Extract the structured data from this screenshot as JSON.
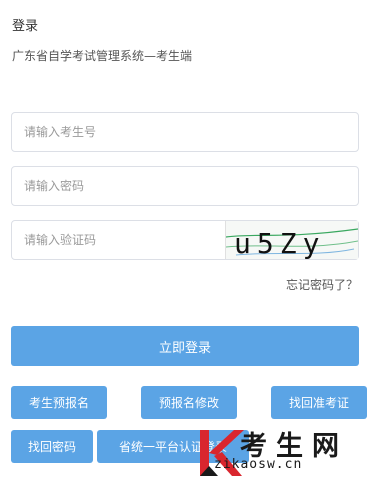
{
  "header": {
    "title": "登录",
    "subtitle": "广东省自学考试管理系统—考生端"
  },
  "form": {
    "username_placeholder": "请输入考生号",
    "password_placeholder": "请输入密码",
    "captcha_placeholder": "请输入验证码",
    "captcha_text": "u5Zy",
    "forgot_password": "忘记密码了？",
    "login_button": "立即登录"
  },
  "actions": [
    {
      "label": "考生预报名"
    },
    {
      "label": "预报名修改"
    },
    {
      "label": "找回准考证"
    },
    {
      "label": "找回密码"
    },
    {
      "label": "省统一平台认证登录"
    }
  ],
  "watermark": {
    "logo_letter": "K",
    "text": "考生网",
    "url": "zikaosw.cn"
  },
  "colors": {
    "primary": "#5ba4e5",
    "watermark_red": "#d9262e"
  }
}
